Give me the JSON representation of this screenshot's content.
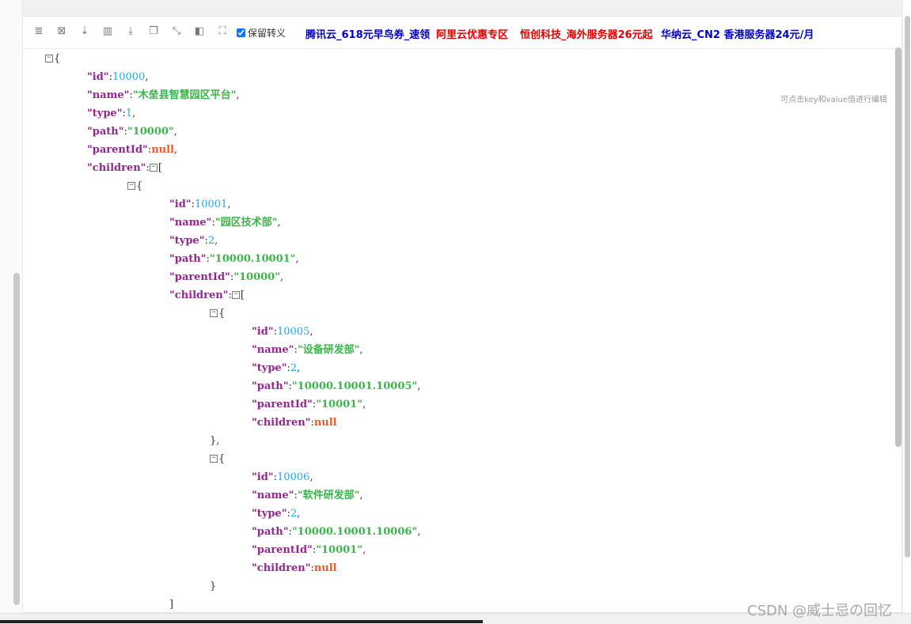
{
  "toolbar": {
    "icons": [
      "database-icon",
      "excel-icon",
      "sort-icon",
      "trash-icon",
      "download-icon",
      "copy-icon",
      "compress-icon",
      "collapse-icon",
      "fullscreen-icon"
    ],
    "keep_escape_label": "保留转义",
    "keep_escape_checked": true,
    "ads": [
      {
        "label": "腾讯云_618元早鸟券_速领",
        "color": "#0000cc"
      },
      {
        "label": "阿里云优惠专区",
        "color": "#e00000"
      },
      {
        "label": "恒创科技_海外服务器26元起",
        "color": "#e00000"
      },
      {
        "label": "华纳云_CN2 香港服务器24元/月",
        "color": "#0000cc"
      }
    ]
  },
  "hint": "可点击key和value值进行编辑",
  "watermark": "CSDN @威士忌の回忆",
  "json_view": {
    "root": {
      "id": "10000",
      "name": "\"木垒县智慧园区平台\"",
      "type": "1",
      "path": "\"10000\"",
      "parentId": "null"
    },
    "child": {
      "id": "10001",
      "name": "\"园区技术部\"",
      "type": "2",
      "path": "\"10000.10001\"",
      "parentId": "\"10000\""
    },
    "grandchildren": [
      {
        "id": "10005",
        "name": "\"设备研发部\"",
        "type": "2",
        "path": "\"10000.10001.10005\"",
        "parentId": "\"10001\"",
        "children": "null"
      },
      {
        "id": "10006",
        "name": "\"软件研发部\"",
        "type": "2",
        "path": "\"10000.10001.10006\"",
        "parentId": "\"10001\"",
        "children": "null"
      }
    ],
    "keys": {
      "id": "\"id\"",
      "name": "\"name\"",
      "type": "\"type\"",
      "path": "\"path\"",
      "parentId": "\"parentId\"",
      "children": "\"children\""
    }
  }
}
